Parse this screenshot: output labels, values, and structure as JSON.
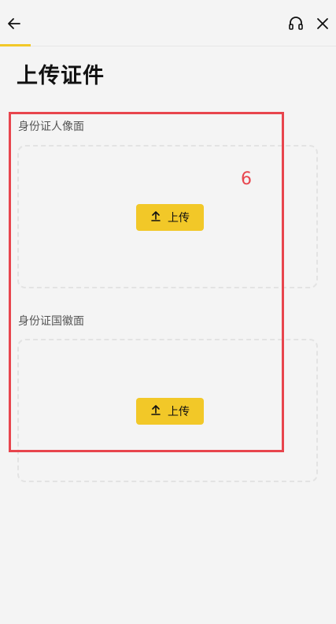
{
  "header": {
    "back_icon": "arrow-left-icon",
    "support_icon": "headset-icon",
    "close_icon": "close-icon",
    "accent_color": "#f2c828"
  },
  "page": {
    "title": "上传证件"
  },
  "sections": [
    {
      "label": "身份证人像面",
      "upload_label": "上传",
      "upload_icon": "upload-arrow-icon"
    },
    {
      "label": "身份证国徽面",
      "upload_label": "上传",
      "upload_icon": "upload-arrow-icon"
    }
  ],
  "annotation": {
    "number": "6",
    "color": "#e8454d"
  }
}
